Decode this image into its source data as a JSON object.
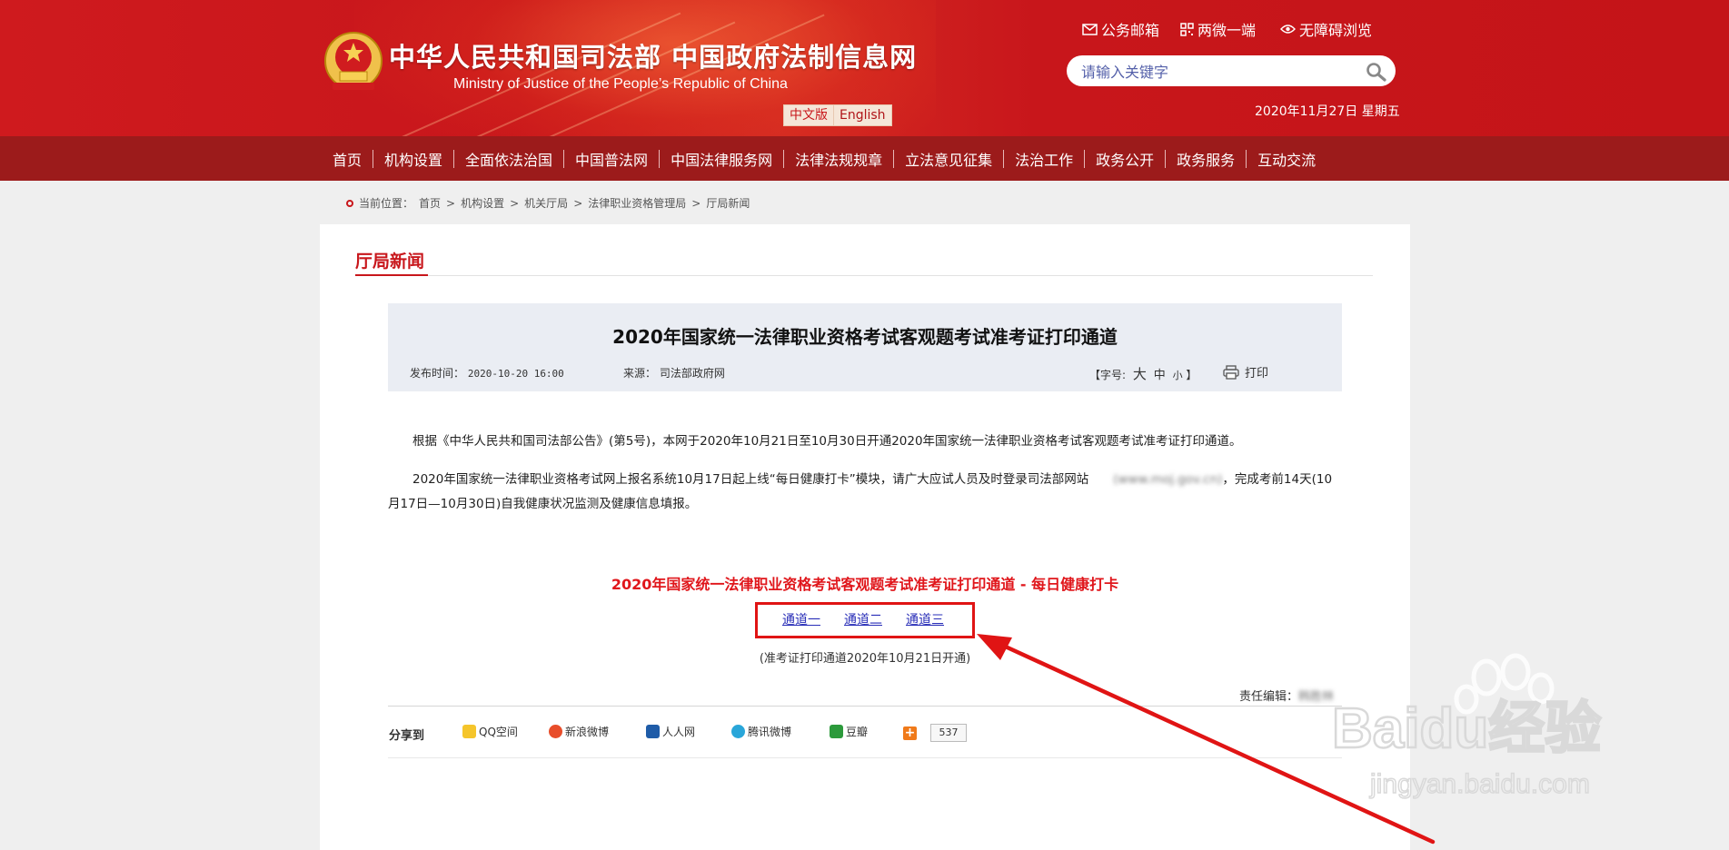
{
  "header": {
    "site_title": "中华人民共和国司法部  中国政府法制信息网",
    "site_subtitle": "Ministry of Justice of the People’s Republic of China",
    "lang_cn": "中文版",
    "lang_en": "English",
    "top_links": [
      "公务邮箱",
      "两微一端",
      "无障碍浏览"
    ],
    "search_placeholder": "请输入关键字",
    "date": "2020年11月27日 星期五"
  },
  "nav": {
    "items": [
      "首页",
      "机构设置",
      "全面依法治国",
      "中国普法网",
      "中国法律服务网",
      "法律法规规章",
      "立法意见征集",
      "法治工作",
      "政务公开",
      "政务服务",
      "互动交流"
    ]
  },
  "breadcrumb": {
    "label": "当前位置：",
    "items": [
      "首页",
      "机构设置",
      "机关厅局",
      "法律职业资格管理局",
      "厅局新闻"
    ],
    "sep": ">"
  },
  "section": {
    "title": "厅局新闻"
  },
  "article": {
    "title": "2020年国家统一法律职业资格考试客观题考试准考证打印通道",
    "publish_label": "发布时间：",
    "publish_time": "2020-10-20 16:00",
    "source_label": "来源：",
    "source": "司法部政府网",
    "fontsize_label": "【字号:",
    "fontsize_large": "大",
    "fontsize_mid": "中",
    "fontsize_small": "小",
    "fontsize_end": "】",
    "print_label": "打印",
    "para1": "根据《中华人民共和国司法部公告》(第5号)，本网于2020年10月21日至10月30日开通2020年国家统一法律职业资格考试客观题考试准考证打印通道。",
    "para2_a": "2020年国家统一法律职业资格考试网上报名系统10月17日起上线“每日健康打卡”模块，请广大应试人员及时登录司法部网站",
    "para2_blur": "(www.moj.gov.cn)",
    "para2_b": "，完成考前14天(10月17日—10月30日)自我健康状况监测及健康信息填报。",
    "red_title": "2020年国家统一法律职业资格考试客观题考试准考证打印通道 - 每日健康打卡",
    "channels": [
      "通道一",
      "通道二",
      "通道三"
    ],
    "note": "(准考证打印通道2020年10月21日开通)",
    "editor_label": "责任编辑：",
    "editor_blur": "韩胜林"
  },
  "share": {
    "label": "分享到",
    "items": [
      "QQ空间",
      "新浪微博",
      "人人网",
      "腾讯微博",
      "豆瓣"
    ],
    "count": "537"
  },
  "watermark": {
    "brand": "Baidu经验",
    "url": "jingyan.baidu.com"
  },
  "colors": {
    "header_red": "#c8161b",
    "nav_red": "#9c1b1b",
    "accent_red": "#e0161b",
    "link_blue": "#2a2fb8",
    "article_head_bg": "#eaedf3"
  }
}
